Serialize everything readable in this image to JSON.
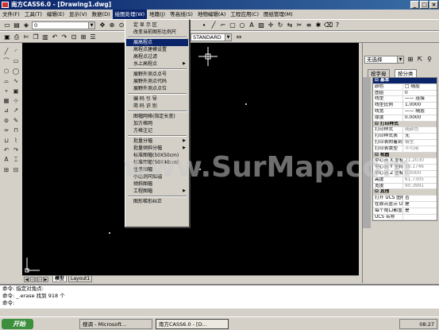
{
  "window": {
    "title": "南方CASS6.0 - [Drawing1.dwg]"
  },
  "menubar": {
    "items": [
      "文件(F)",
      "工具(T)",
      "编辑(E)",
      "显示(V)",
      "数据(D)",
      "绘图处理(W)",
      "地籍(J)",
      "等高线(S)",
      "地物编辑(A)",
      "工程应用(C)",
      "图纸管理(M)"
    ],
    "active_index": 5
  },
  "toolbar": {
    "layer_combo": "0",
    "linetype_combo": "BYLAYER",
    "lineweight_combo": "BYLAYER",
    "color_combo": "BYLAYER",
    "style_combo": "STANDARD"
  },
  "dropdown": {
    "items": [
      {
        "label": "定 显 示 区",
        "submenu": false
      },
      {
        "label": "改变当前图形比例尺",
        "submenu": false
      },
      {
        "sep": true
      },
      {
        "label": "展高程点",
        "submenu": false,
        "highlight": true
      },
      {
        "label": "高程点建模设置",
        "submenu": false
      },
      {
        "label": "高程点过滤",
        "submenu": false
      },
      {
        "label": "水上高程点",
        "submenu": true
      },
      {
        "sep": true
      },
      {
        "label": "展野外测点点号",
        "submenu": false
      },
      {
        "label": "展野外测点代码",
        "submenu": false
      },
      {
        "label": "展野外测点点位",
        "submenu": false
      },
      {
        "sep": true
      },
      {
        "label": "编 码 引 导",
        "submenu": false
      },
      {
        "label": "简 码 识 别",
        "submenu": false
      },
      {
        "sep": true
      },
      {
        "label": "图幅网格(指定长宽)",
        "submenu": false
      },
      {
        "label": "加方格网",
        "submenu": false
      },
      {
        "label": "方格注记",
        "submenu": false
      },
      {
        "sep": true
      },
      {
        "label": "批量分幅",
        "submenu": true
      },
      {
        "label": "批量倾斜分幅",
        "submenu": true
      },
      {
        "label": "标准图幅(50X50cm)",
        "submenu": false
      },
      {
        "label": "标准图幅(50X40cm)",
        "submenu": false
      },
      {
        "label": "任意图幅",
        "submenu": false
      },
      {
        "label": "小比例尺图幅",
        "submenu": false
      },
      {
        "label": "倾斜图幅",
        "submenu": false
      },
      {
        "label": "工程图幅",
        "submenu": true
      },
      {
        "sep": true
      },
      {
        "label": "图形梯形纠正",
        "submenu": false
      }
    ]
  },
  "canvas": {
    "tabs": [
      "模型",
      "Layout1"
    ],
    "active_tab": 0
  },
  "rightpanel": {
    "selector": "无选择",
    "tabs": [
      "按字母",
      "按分类"
    ],
    "active_tab": 1,
    "rows": [
      {
        "type": "cat",
        "k": "基本",
        "sel": true
      },
      {
        "k": "颜色",
        "v": "□ 随层"
      },
      {
        "k": "图层",
        "v": "0"
      },
      {
        "k": "线型",
        "v": "—— 连接"
      },
      {
        "k": "线型比例",
        "v": "1.0000"
      },
      {
        "k": "线宽",
        "v": "—— 随层"
      },
      {
        "k": "厚度",
        "v": "0.0000"
      },
      {
        "type": "cat",
        "k": "打印样式"
      },
      {
        "k": "打印样式",
        "v": "随颜色",
        "dim": true
      },
      {
        "k": "打印样式表",
        "v": "无"
      },
      {
        "k": "打印表附着到",
        "v": "模型",
        "dim": true
      },
      {
        "k": "打印表类型",
        "v": "不可用",
        "dim": true
      },
      {
        "type": "cat",
        "k": "视图"
      },
      {
        "k": "中心点 X 坐标",
        "v": "21.2030",
        "dim": true
      },
      {
        "k": "中心点 Y 坐标",
        "v": "36.1746",
        "dim": true
      },
      {
        "k": "中心点 Z 坐标",
        "v": "0.0000",
        "dim": true
      },
      {
        "k": "高度",
        "v": "61.7305",
        "dim": true
      },
      {
        "k": "宽度",
        "v": "90.3991",
        "dim": true
      },
      {
        "type": "cat",
        "k": "其他"
      },
      {
        "k": "打开 UCS 图标",
        "v": "否"
      },
      {
        "k": "在原点显示 UCS",
        "v": "是"
      },
      {
        "k": "每个视口都显示 UCS",
        "v": "是"
      },
      {
        "k": "UCS 名称",
        "v": ""
      }
    ]
  },
  "command": {
    "lines": [
      "命令: 指定对角点:",
      "命令: _.erase 找到 918 个",
      "命令:"
    ]
  },
  "taskbar": {
    "start": "开始",
    "items": [
      "搜调 - Microsoft...",
      "南方CASS6.0 - [D..."
    ],
    "active_index": 1,
    "clock": "08:27"
  },
  "watermark": {
    "text": "www.SurMap.com"
  },
  "colors": {
    "accent": "#0a246a",
    "canvas": "#000000",
    "taskbar_start": "#3c8f3c"
  }
}
